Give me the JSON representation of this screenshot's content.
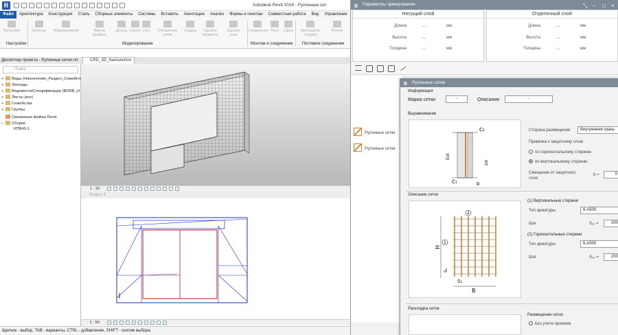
{
  "revit": {
    "logo": "R",
    "title": "Autodesk Revit 2024 - Рулонные сет",
    "menu": [
      "Файл",
      "Архитектура",
      "Конструкция",
      "Сталь",
      "Сборные элементы",
      "Системы",
      "Вставить",
      "Аннотации",
      "Анализ",
      "Формы и генплан",
      "Совместная работа",
      "Вид",
      "Управление",
      "Н"
    ],
    "ribbon": {
      "buttons": [
        "Настройки",
        "Колонны",
        "Моделирование",
        "Ввести профиль",
        "Деталь",
        "Сквозн.",
        "Сито",
        "Обновление узлов",
        "Создать",
        "Удалить элементы",
        "Сделать узлы",
        "Соединение",
        "Поля",
        "Связи",
        "Автоподбор стержня",
        "Ручное"
      ],
      "groups": [
        "Настройки",
        "Моделирование",
        "Монтаж и соединение",
        "Петлевое соединение"
      ]
    },
    "project_browser": {
      "title": "Диспетчер проекта - Рулонные сетки.rvt",
      "search_placeholder": "Поиск",
      "items": [
        {
          "toggle": "+",
          "label": "Виды (Назначение_Раздел_Семейство)"
        },
        {
          "toggle": "+",
          "label": "Легенды"
        },
        {
          "toggle": "+",
          "label": "Ведомости/Спецификации (BDRB_Н"
        },
        {
          "toggle": "+",
          "label": "Листы (все)"
        },
        {
          "toggle": "+",
          "label": "Семейства"
        },
        {
          "toggle": "+",
          "label": "Группы"
        },
        {
          "toggle": "",
          "label": "Связанные файлы Revit"
        },
        {
          "toggle": "−",
          "label": "Сборки"
        },
        {
          "toggle": "",
          "label": "КПВ43-1"
        }
      ]
    },
    "view_tab": {
      "label": "CRD_3D_Navisworks",
      "close": "×"
    },
    "view1_scale": "1 : 10",
    "view2_header": "Разрез 1",
    "view2_scale": "1 : 50",
    "status": "Щелчок - выбор, TAB - варианты, CTRL - добавление, SHIFT - снятие выбора."
  },
  "params": {
    "logo": "B",
    "title": "Параметры армирования",
    "controls": [
      "⤡",
      "–",
      "□",
      "×"
    ],
    "bearing": {
      "title": "Несущий слой",
      "rows": [
        {
          "label": "Длина",
          "value": "....",
          "unit": "мм"
        },
        {
          "label": "Высота",
          "value": "....",
          "unit": "мм"
        },
        {
          "label": "Толщина",
          "value": "....",
          "unit": "мм"
        }
      ]
    },
    "facing": {
      "title": "Отделочный слой",
      "rows": [
        {
          "label": "Длина",
          "value": "....",
          "unit": "мм"
        },
        {
          "label": "Высота",
          "value": "....",
          "unit": "мм"
        },
        {
          "label": "Толщина",
          "value": "....",
          "unit": "мм"
        }
      ]
    },
    "list": [
      "Рулонные сетки",
      "Рулонные сетки"
    ]
  },
  "mesh": {
    "logo": "B",
    "title": "Рулонные сетки",
    "info": {
      "section": "Информация",
      "mark_label": "Марка сетки",
      "mark_value": "-",
      "desc_label": "Описание",
      "desc_value": "-"
    },
    "align": {
      "section": "Выравнивание",
      "side_label": "Сторона размещения",
      "side_value": "Внутренняя грань",
      "bind_label": "Привязка к защитному слою",
      "opt_horizontal": "по горизонтальному стержню",
      "opt_vertical": "по вертикальному стержню",
      "offset_label": "Смещение от защитного слоя",
      "offset_sym": "b =",
      "offset_value": "0",
      "fig_c2": "C₂",
      "fig_ext": "Ext",
      "fig_int": "Int",
      "fig_c1": "C₁",
      "fig_b": "b"
    },
    "describe": {
      "section": "Описание сеток",
      "vert_title": "(1) Вертикальные стержни",
      "vert_type_label": "Тип арматуры",
      "vert_type_value": "6-A500",
      "vert_step_label": "Шаг",
      "vert_step_sym": "S₀₁ =",
      "vert_step_value": "200",
      "hor_title": "(2) Горизонтальные стержни",
      "hor_type_label": "Тип арматуры",
      "hor_type_value": "6-A500",
      "hor_step_label": "Шаг",
      "hor_step_sym": "S₀₂ =",
      "hor_step_value": "200",
      "fig_n1": "1",
      "fig_n2": "2",
      "fig_h": "H",
      "fig_s2": "S₂",
      "fig_s1": "S₁",
      "fig_b": "B"
    },
    "layout": {
      "section": "Раскладка сеток",
      "placement_title": "Размещение сеток",
      "opt_no_openings": "Без учета проемов"
    }
  },
  "colors": {
    "revit_blue": "#1e5aa8",
    "dialog_title": "#7e8b97",
    "rebar": "#d08030"
  }
}
